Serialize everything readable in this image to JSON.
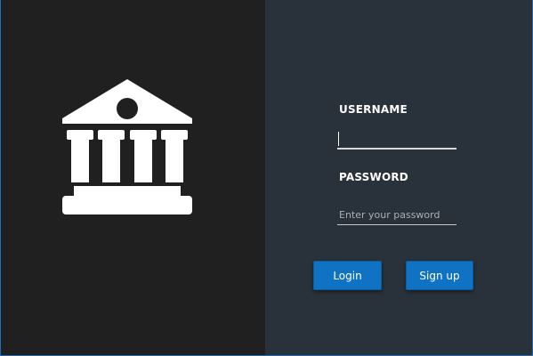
{
  "logo": {
    "icon": "bank-building-icon",
    "color": "#ffffff"
  },
  "login_form": {
    "username_label": "USERNAME",
    "username_value": "",
    "password_label": "PASSWORD",
    "password_placeholder": "Enter your password",
    "password_value": "",
    "login_label": "Login",
    "signup_label": "Sign up"
  },
  "colors": {
    "left_background": "#202020",
    "right_background": "#29323a",
    "button_accent": "#0f72c3",
    "window_border": "#1f6fb8"
  }
}
